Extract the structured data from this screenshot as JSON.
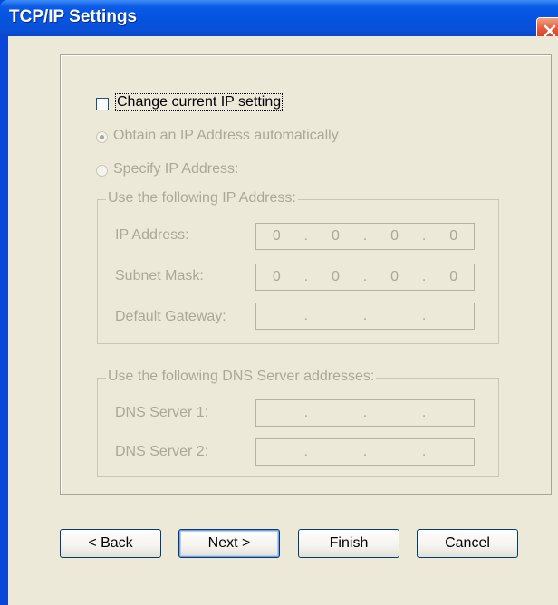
{
  "window": {
    "title": "TCP/IP Settings"
  },
  "change_setting": {
    "label": "Change current IP setting",
    "checked": false
  },
  "mode": {
    "auto_label": "Obtain an IP Address automatically",
    "specify_label": "Specify IP Address:",
    "selected": "auto"
  },
  "ip_group": {
    "legend": "Use the following IP Address:",
    "fields": [
      {
        "label": "IP Address:",
        "octets": [
          "0",
          "0",
          "0",
          "0"
        ]
      },
      {
        "label": "Subnet Mask:",
        "octets": [
          "0",
          "0",
          "0",
          "0"
        ]
      },
      {
        "label": "Default Gateway:",
        "octets": [
          "",
          "",
          "",
          ""
        ]
      }
    ]
  },
  "dns_group": {
    "legend": "Use the following DNS Server addresses:",
    "fields": [
      {
        "label": "DNS Server 1:",
        "octets": [
          "",
          "",
          "",
          ""
        ]
      },
      {
        "label": "DNS Server 2:",
        "octets": [
          "",
          "",
          "",
          ""
        ]
      }
    ]
  },
  "buttons": {
    "back": "< Back",
    "next": "Next >",
    "finish": "Finish",
    "cancel": "Cancel"
  },
  "colors": {
    "title_bar": "#0453de",
    "dialog_bg": "#ece9d8",
    "disabled_text": "#aca899"
  }
}
